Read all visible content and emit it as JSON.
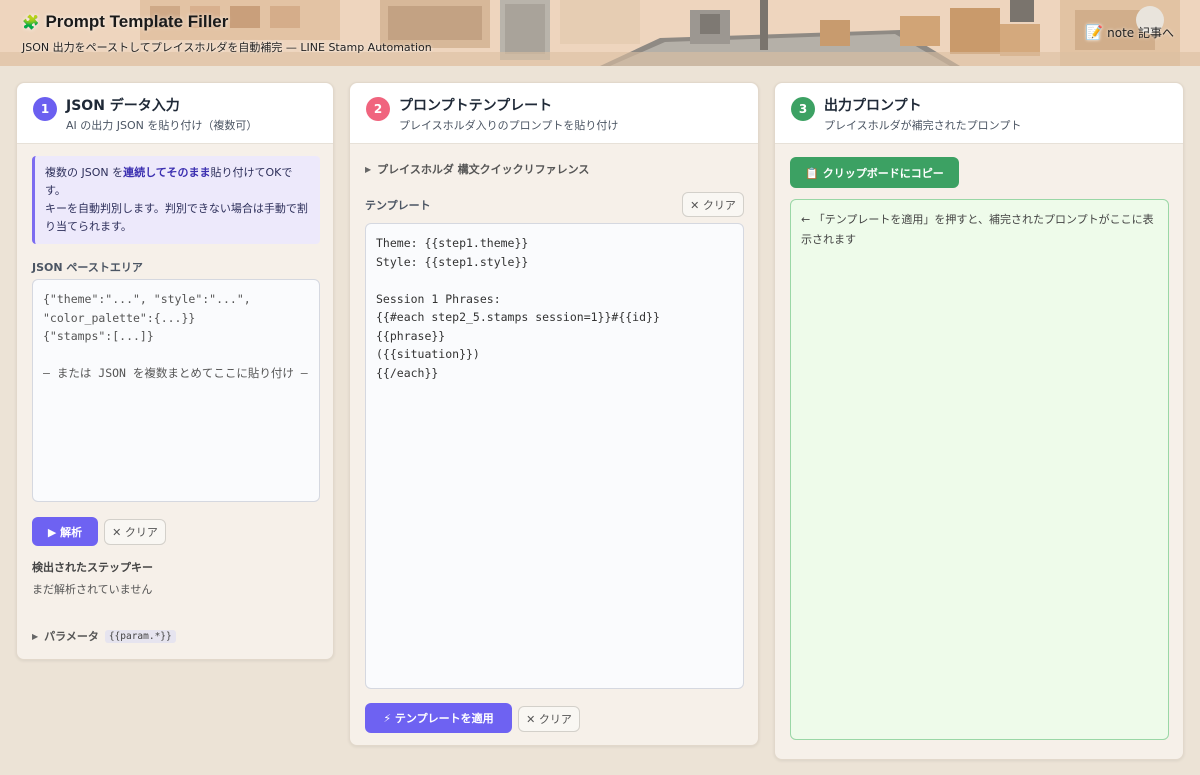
{
  "header": {
    "title": "Prompt Template Filler",
    "subtitle": "JSON 出力をペーストしてプレイスホルダを自動補完 — LINE Stamp Automation",
    "note_link": "note 記事へ",
    "logo_icon": "puzzle-icon",
    "note_icon": "memo-icon"
  },
  "panel1": {
    "number": "1",
    "title": "JSON データ入力",
    "subtitle": "AI の出力 JSON を貼り付け（複数可）",
    "info_pre": "複数の JSON を",
    "info_bold": "連続してそのまま",
    "info_post": "貼り付けてOKです。",
    "info_line2": "キーを自動判別します。判別できない場合は手動で割り当てられます。",
    "paste_label": "JSON ペーストエリア",
    "paste_placeholder": "{\"theme\":\"...\", \"style\":\"...\",\n\"color_palette\":{...}}\n{\"stamps\":[...]}\n\n— または JSON を複数まとめてここに貼り付け —",
    "parse_button": "▶ 解析",
    "clear_button": "✕ クリア",
    "detected_label": "検出されたステップキー",
    "detected_empty": "まだ解析されていません",
    "param_label": "パラメータ",
    "param_code": "{{param.*}}"
  },
  "panel2": {
    "number": "2",
    "title": "プロンプトテンプレート",
    "subtitle": "プレイスホルダ入りのプロンプトを貼り付け",
    "quickref": "プレイスホルダ 構文クイックリファレンス",
    "template_label": "テンプレート",
    "clear_button": "✕ クリア",
    "template_value": "Theme: {{step1.theme}}\nStyle: {{step1.style}}\n\nSession 1 Phrases:\n{{#each step2_5.stamps session=1}}#{{id}} {{phrase}}\n({{situation}})\n{{/each}}",
    "apply_button": "⚡ テンプレートを適用",
    "clear_button2": "✕ クリア"
  },
  "panel3": {
    "number": "3",
    "title": "出力プロンプト",
    "subtitle": "プレイスホルダが補完されたプロンプト",
    "copy_button": "📋 クリップボードにコピー",
    "output_placeholder": "← 「テンプレートを適用」を押すと、補完されたプロンプトがここに表示されます"
  },
  "colors": {
    "step1": "#6b5ff0",
    "step2": "#f0647e",
    "step3": "#3ca163",
    "primary_button": "#6e62f2",
    "copy_button": "#3ca163"
  }
}
